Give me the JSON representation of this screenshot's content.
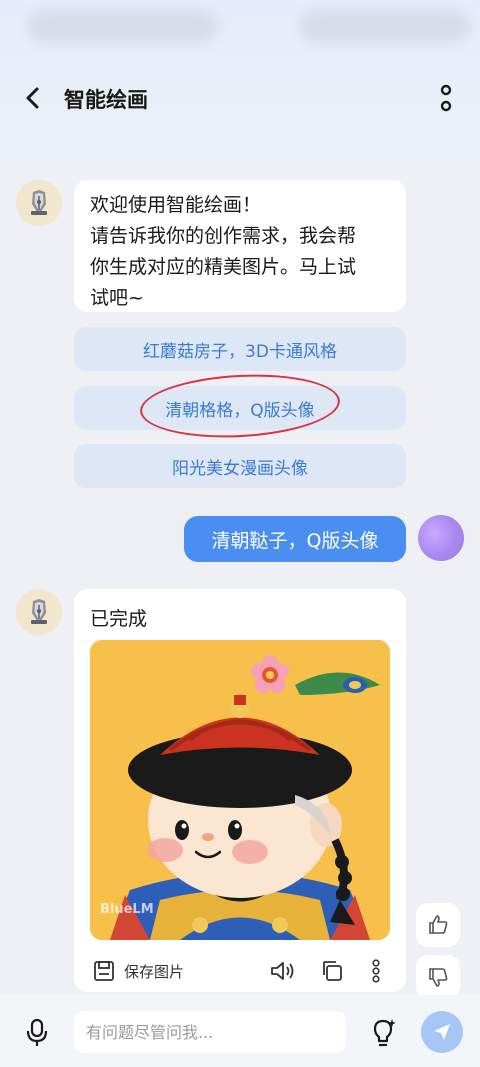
{
  "header": {
    "title": "智能绘画"
  },
  "welcome": {
    "line1": "欢迎使用智能绘画！",
    "line2": "请告诉我你的创作需求，我会帮",
    "line3": "你生成对应的精美图片。马上试",
    "line4": "试吧~"
  },
  "suggestions": [
    {
      "label": "红蘑菇房子，3D卡通风格"
    },
    {
      "label": "清朝格格，Q版头像"
    },
    {
      "label": "阳光美女漫画头像"
    }
  ],
  "user_message": {
    "text": "清朝鞑子，Q版头像"
  },
  "result": {
    "status": "已完成",
    "save_label": "保存图片",
    "image_watermark": "BlueLM"
  },
  "input": {
    "placeholder": "有问题尽管问我..."
  },
  "colors": {
    "accent": "#4a8ef2",
    "suggest_bg": "#dde7f5",
    "suggest_text": "#3b7bd8",
    "annotation_red": "#d9333f",
    "art_bg": "#f7c04a"
  },
  "icons": {
    "back": "chevron-left-icon",
    "more": "vertical-dots-icon",
    "save": "save-icon",
    "speaker": "speaker-icon",
    "copy": "copy-icon",
    "thumb_up": "thumb-up-icon",
    "thumb_down": "thumb-down-icon",
    "mic": "microphone-icon",
    "bulb": "lightbulb-icon",
    "send": "send-icon"
  }
}
